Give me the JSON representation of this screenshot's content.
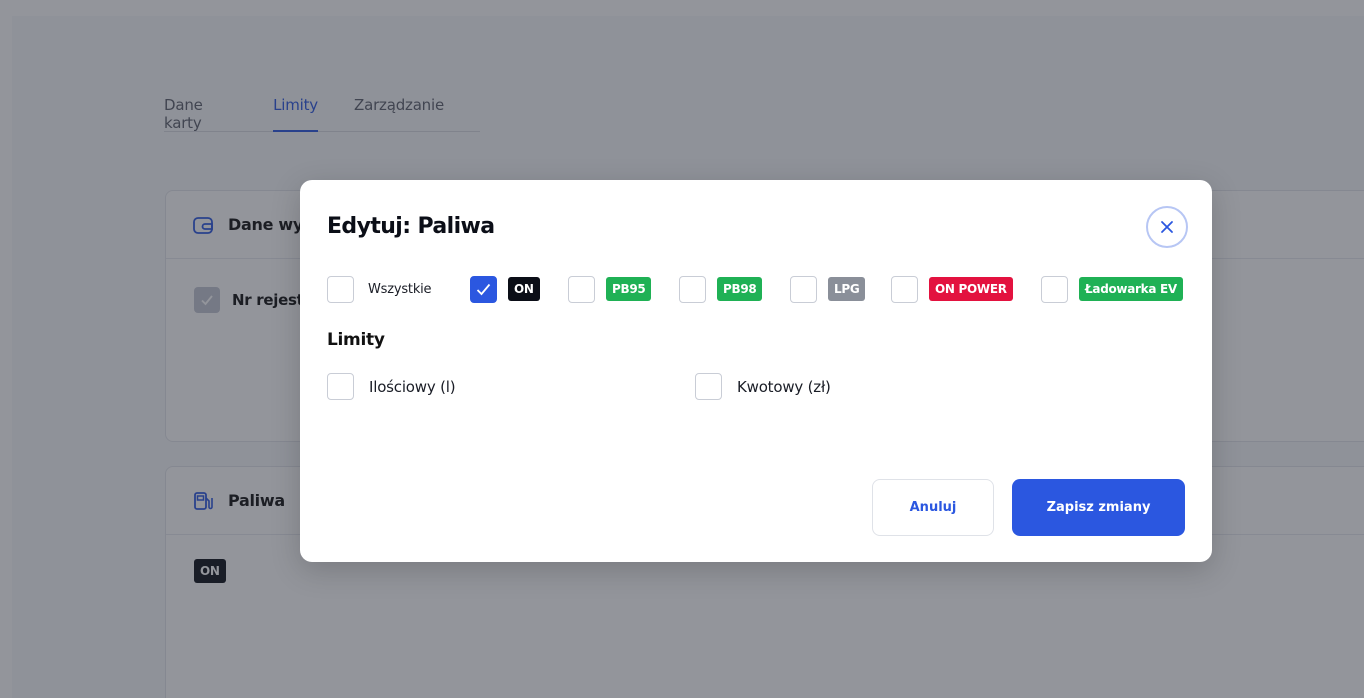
{
  "tabs": [
    {
      "label": "Dane karty",
      "active": false
    },
    {
      "label": "Limity",
      "active": true
    },
    {
      "label": "Zarządzanie",
      "active": false
    }
  ],
  "background_cards": {
    "vehicle": {
      "title": "Dane wy",
      "row_label": "Nr rejest"
    },
    "fuels": {
      "title": "Paliwa",
      "badge": "ON"
    }
  },
  "modal": {
    "title": "Edytuj: Paliwa",
    "fuel_options": [
      {
        "label": "Wszystkie",
        "checked": false,
        "type": "text"
      },
      {
        "label": "ON",
        "checked": true,
        "type": "badge",
        "color": "#0b0e17"
      },
      {
        "label": "PB95",
        "checked": false,
        "type": "badge",
        "color": "#1fb155"
      },
      {
        "label": "PB98",
        "checked": false,
        "type": "badge",
        "color": "#1fb155"
      },
      {
        "label": "LPG",
        "checked": false,
        "type": "badge",
        "color": "#8a8f99"
      },
      {
        "label": "ON POWER",
        "checked": false,
        "type": "badge",
        "color": "#e3123f"
      },
      {
        "label": "Ładowarka EV",
        "checked": false,
        "type": "badge",
        "color": "#1fb155"
      }
    ],
    "limits_title": "Limity",
    "limits": [
      {
        "label": "Ilościowy (l)",
        "checked": false
      },
      {
        "label": "Kwotowy (zł)",
        "checked": false
      }
    ],
    "cancel_label": "Anuluj",
    "save_label": "Zapisz zmiany"
  },
  "colors": {
    "accent": "#2b57e0"
  }
}
